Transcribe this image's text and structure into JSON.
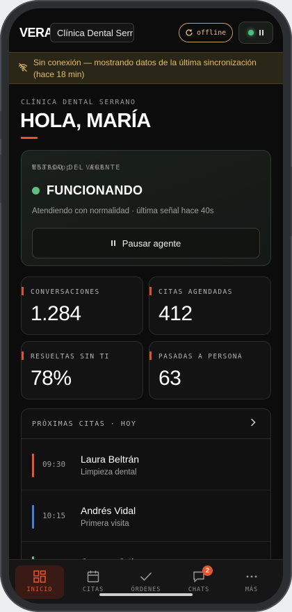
{
  "topbar": {
    "logo": "VERA",
    "clinic_select": "Clínica Dental Serr…",
    "offline_label": "offline"
  },
  "banner": {
    "text": "Sin conexión — mostrando datos de la última sincronización (hace 18 min)"
  },
  "header": {
    "clinic_name": "CLÍNICA DENTAL SERRANO",
    "greeting": "HOLA, MARÍA"
  },
  "agent": {
    "section_label": "ESTADO DEL AGENTE",
    "channel": "WhatsApp · VERA",
    "status": "FUNCIONANDO",
    "detail": "Atendiendo con normalidad · última señal hace 40s",
    "pause_label": "Pausar agente"
  },
  "stats": [
    {
      "label": "CONVERSACIONES",
      "value": "1.284"
    },
    {
      "label": "CITAS AGENDADAS",
      "value": "412"
    },
    {
      "label": "RESUELTAS SIN TI",
      "value": "78%"
    },
    {
      "label": "PASADAS A PERSONA",
      "value": "63"
    }
  ],
  "appointments": {
    "title": "PRÓXIMAS CITAS · HOY",
    "items": [
      {
        "time": "09:30",
        "name": "Laura Beltrán",
        "type": "Limpieza dental",
        "color": "#e2572e"
      },
      {
        "time": "10:15",
        "name": "Andrés Vidal",
        "type": "Primera visita",
        "color": "#4a7fe0"
      },
      {
        "time": "",
        "name": "Carmen Ortiz",
        "type": "",
        "color": "#5cc07e"
      }
    ]
  },
  "nav": {
    "items": [
      {
        "label": "INICIO",
        "icon": "grid-icon"
      },
      {
        "label": "CITAS",
        "icon": "calendar-icon"
      },
      {
        "label": "ÓRDENES",
        "icon": "check-icon"
      },
      {
        "label": "CHATS",
        "icon": "chat-icon",
        "badge": "2"
      },
      {
        "label": "MÁS",
        "icon": "more-icon"
      }
    ]
  },
  "colors": {
    "accent": "#e2572e",
    "online": "#5cc07e",
    "warning": "#e3bd6c"
  }
}
